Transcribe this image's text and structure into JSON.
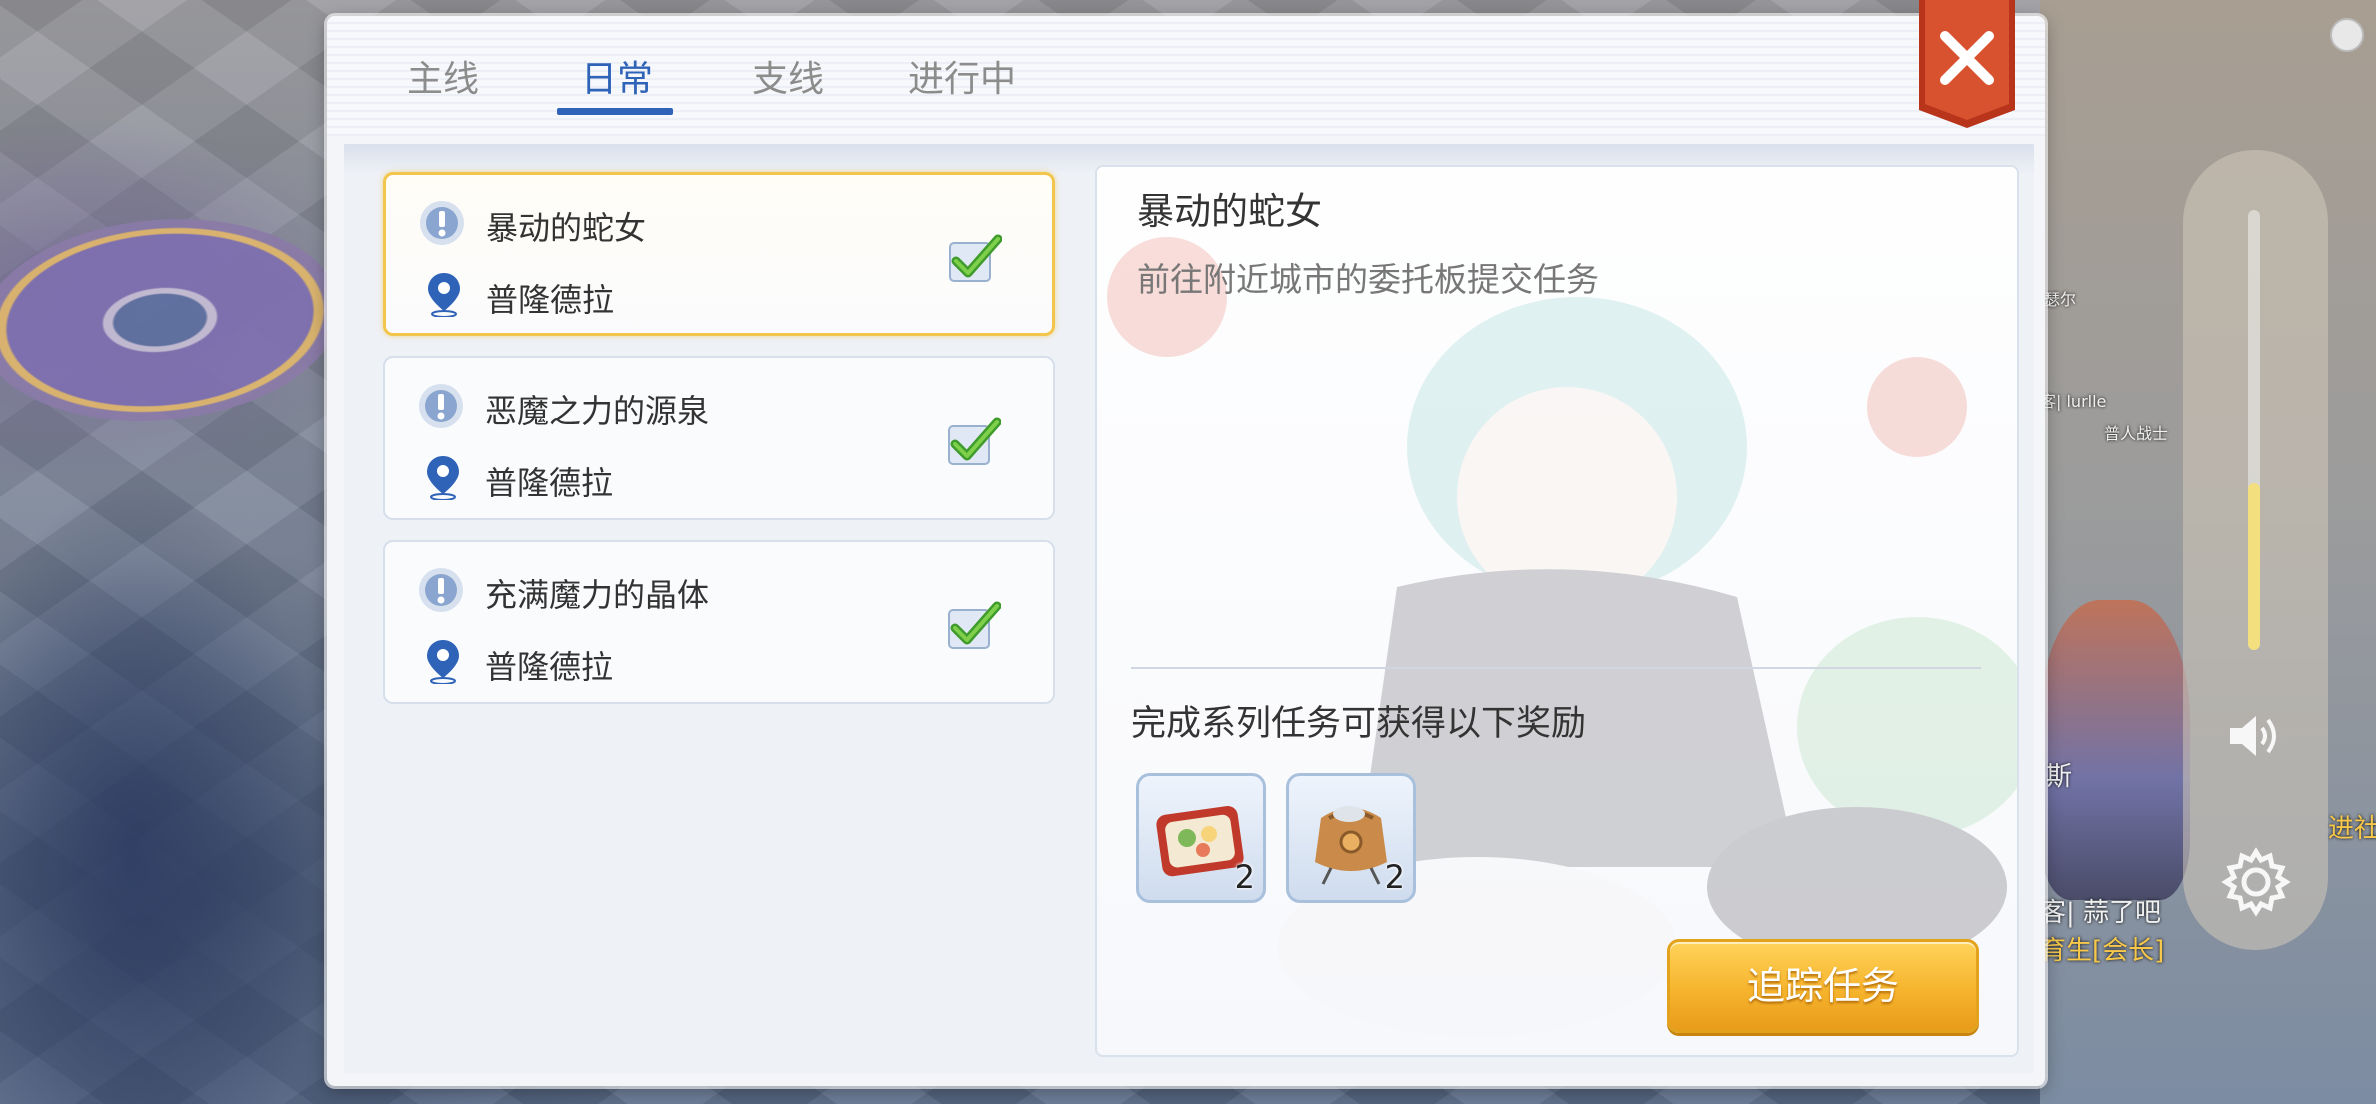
{
  "tabs": [
    {
      "label": "主线",
      "active": false
    },
    {
      "label": "日常",
      "active": true
    },
    {
      "label": "支线",
      "active": false
    },
    {
      "label": "进行中",
      "active": false
    }
  ],
  "quests": [
    {
      "title": "暴动的蛇女",
      "location": "普隆德拉",
      "completed": true,
      "selected": true
    },
    {
      "title": "恶魔之力的源泉",
      "location": "普隆德拉",
      "completed": true,
      "selected": false
    },
    {
      "title": "充满魔力的晶体",
      "location": "普隆德拉",
      "completed": true,
      "selected": false
    }
  ],
  "detail": {
    "title": "暴动的蛇女",
    "description": "前往附近城市的委托板提交任务",
    "reward_heading": "完成系列任务可获得以下奖励",
    "rewards": [
      {
        "icon": "food-box-icon",
        "quantity": "2"
      },
      {
        "icon": "pouch-bag-icon",
        "quantity": "2"
      }
    ],
    "track_button": "追踪任务"
  },
  "side_widget": {
    "volume_level": 0.38,
    "speaker_icon": "speaker-icon",
    "settings_icon": "gear-icon"
  },
  "world_labels": [
    {
      "text": "客| 蒜了吧",
      "gold": false
    },
    {
      "text": "育生[会长]",
      "gold": true
    },
    {
      "text": "进社",
      "gold": true
    },
    {
      "text": "客| lurlle",
      "gold": false
    },
    {
      "text": "普人战士",
      "gold": false
    },
    {
      "text": "瑟尔",
      "gold": false
    },
    {
      "text": "斯",
      "gold": false
    }
  ],
  "colors": {
    "accent": "#2f63b8",
    "selected_border": "#f2c64d",
    "close_button": "#cc4a2a",
    "track_button": "#f6b42d"
  }
}
